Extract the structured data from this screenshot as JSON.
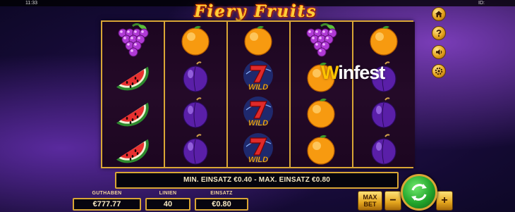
{
  "status_bar": {
    "clock": "11:33",
    "id_label": "ID:"
  },
  "game": {
    "title": "Fiery Fruits"
  },
  "watermark": {
    "first_letter": "W",
    "rest": "infest"
  },
  "reels": [
    [
      "grapes",
      "watermelon",
      "watermelon",
      "watermelon"
    ],
    [
      "orange",
      "plum",
      "plum",
      "plum"
    ],
    [
      "orange",
      "wild",
      "wild",
      "wild"
    ],
    [
      "grapes",
      "orange",
      "orange",
      "orange"
    ],
    [
      "orange",
      "plum",
      "plum",
      "plum"
    ]
  ],
  "wild_label": "WILD",
  "info_banner": "MIN. EINSATZ €0.40 - MAX. EINSATZ €0.80",
  "balance": {
    "label": "GUTHABEN",
    "value": "€777.77"
  },
  "lines": {
    "label": "LINIEN",
    "value": "40"
  },
  "bet": {
    "label": "EINSATZ",
    "value": "€0.80"
  },
  "buttons": {
    "max_bet_line1": "MAX",
    "max_bet_line2": "BET",
    "minus": "−",
    "plus": "+"
  },
  "side_icons": [
    "home-icon",
    "help-icon",
    "sound-icon",
    "settings-icon"
  ],
  "colors": {
    "frame_gold": "#d9a635",
    "reel_bg": "#240a28",
    "spin_green": "#22a52b",
    "watermark_yellow": "#ffc400"
  }
}
